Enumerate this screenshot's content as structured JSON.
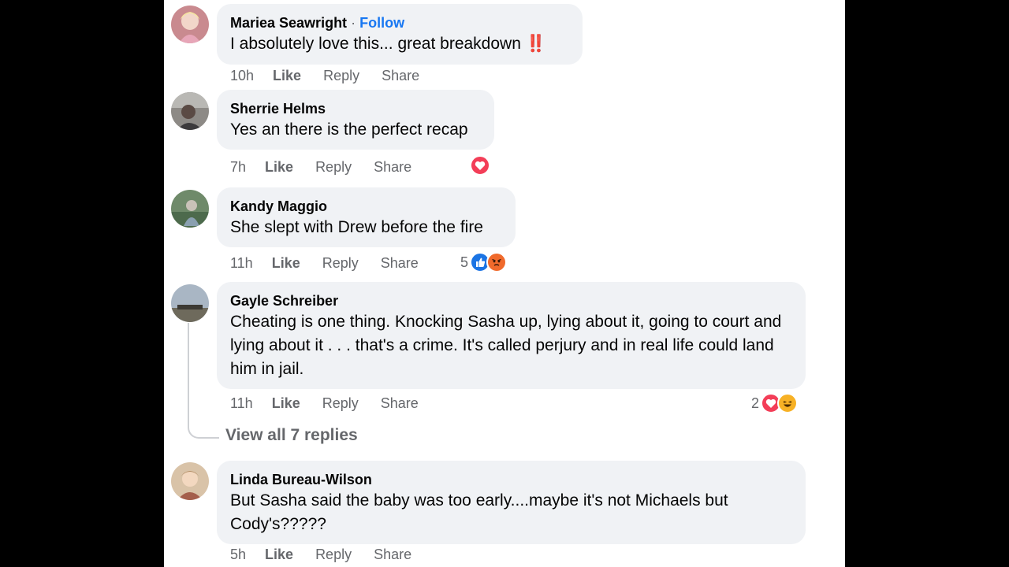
{
  "comments": [
    {
      "author": "Mariea Seawright",
      "follow_label": "Follow",
      "separator": "·",
      "text": "I absolutely love this... great breakdown",
      "emoji_suffix": "‼️",
      "time": "10h",
      "like_label": "Like",
      "reply_label": "Reply",
      "share_label": "Share"
    },
    {
      "author": "Sherrie Helms",
      "text": "Yes an there is the perfect recap",
      "time": "7h",
      "like_label": "Like",
      "reply_label": "Reply",
      "share_label": "Share",
      "reactions": [
        "heart"
      ]
    },
    {
      "author": "Kandy Maggio",
      "text": "She slept with Drew before the fire",
      "time": "11h",
      "like_label": "Like",
      "reply_label": "Reply",
      "share_label": "Share",
      "reaction_count": "5",
      "reactions": [
        "like",
        "angry"
      ]
    },
    {
      "author": "Gayle Schreiber",
      "text": "Cheating is one thing. Knocking Sasha up, lying about it, going to court and lying about it . . . that's a crime. It's called perjury and in real life could land him in jail.",
      "time": "11h",
      "like_label": "Like",
      "reply_label": "Reply",
      "share_label": "Share",
      "reaction_count": "2",
      "reactions": [
        "heart",
        "haha"
      ],
      "view_replies_label": "View all 7 replies"
    },
    {
      "author": "Linda Bureau-Wilson",
      "text": "But Sasha said the baby was too early....maybe it's not Michaels but Cody's?????",
      "time": "5h",
      "like_label": "Like",
      "reply_label": "Reply",
      "share_label": "Share"
    }
  ],
  "colors": {
    "bubble": "#f0f2f5",
    "link": "#1877f2",
    "meta": "#65676b",
    "heart": "#f33e58",
    "like": "#1b74e4"
  }
}
